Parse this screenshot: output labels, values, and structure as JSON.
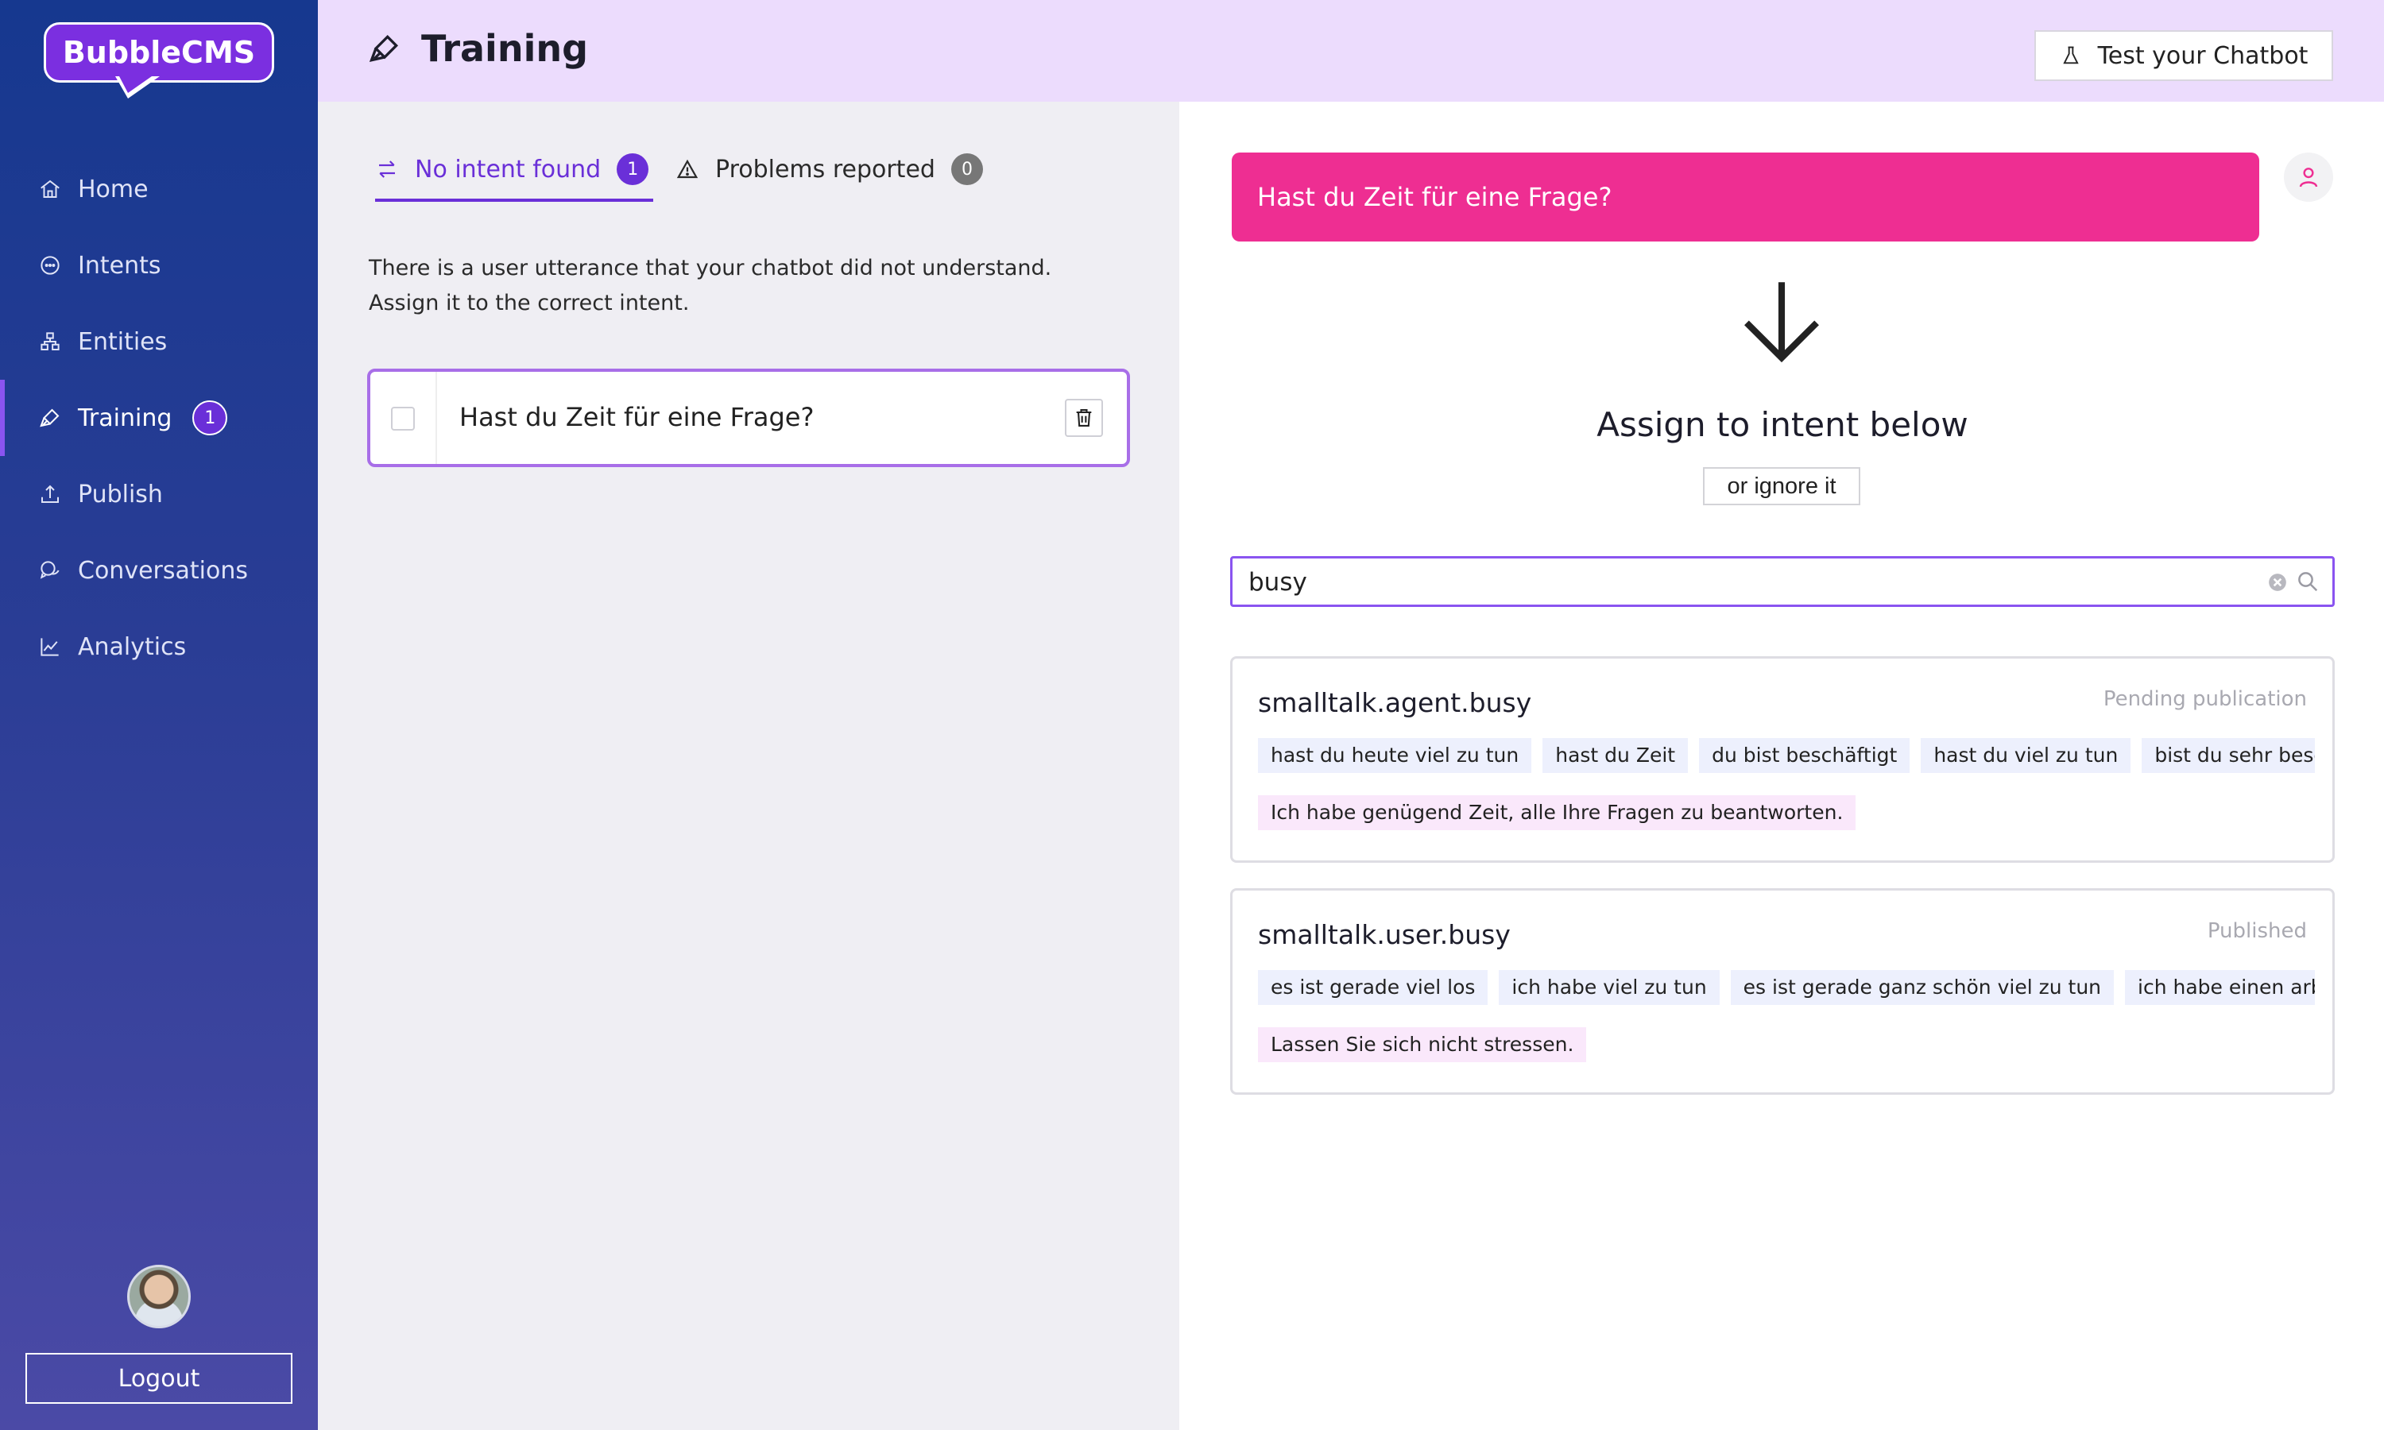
{
  "brand": {
    "logo_text": "BubbleCMS"
  },
  "sidebar": {
    "items": [
      {
        "label": "Home",
        "icon": "home-icon"
      },
      {
        "label": "Intents",
        "icon": "chat-icon"
      },
      {
        "label": "Entities",
        "icon": "entities-icon"
      },
      {
        "label": "Training",
        "icon": "training-icon",
        "badge": "1",
        "active": true
      },
      {
        "label": "Publish",
        "icon": "upload-icon"
      },
      {
        "label": "Conversations",
        "icon": "conversations-icon"
      },
      {
        "label": "Analytics",
        "icon": "analytics-icon"
      }
    ],
    "logout_label": "Logout"
  },
  "header": {
    "title": "Training",
    "test_button_label": "Test your Chatbot"
  },
  "tabs": [
    {
      "label": "No intent found",
      "count": "1",
      "active": true
    },
    {
      "label": "Problems reported",
      "count": "0",
      "active": false
    }
  ],
  "intro": {
    "line1": "There is a user utterance that your chatbot did not understand.",
    "line2": "Assign it to the correct intent."
  },
  "utterance": {
    "text": "Hast du Zeit für eine Frage?"
  },
  "assign": {
    "bubble_text": "Hast du Zeit für eine Frage?",
    "title": "Assign to intent below",
    "ignore_label": "or ignore it"
  },
  "search": {
    "value": "busy",
    "placeholder": ""
  },
  "intents": [
    {
      "name": "smalltalk.agent.busy",
      "status": "Pending publication",
      "phrases": [
        "hast du heute viel zu tun",
        "hast du Zeit",
        "du bist beschäftigt",
        "hast du viel zu tun",
        "bist du sehr beschäftigt"
      ],
      "response": "Ich habe genügend Zeit, alle Ihre Fragen zu beantworten."
    },
    {
      "name": "smalltalk.user.busy",
      "status": "Published",
      "phrases": [
        "es ist gerade viel los",
        "ich habe viel zu tun",
        "es ist gerade ganz schön viel zu tun",
        "ich habe einen arbeitsreichen Tag"
      ],
      "response": "Lassen Sie sich nicht stressen."
    }
  ],
  "colors": {
    "accent": "#6a2fd8",
    "header_bg": "#ecdcfd",
    "bubble": "#ee2e92",
    "sidebar_top": "#16388f",
    "sidebar_bottom": "#4b4aa6"
  }
}
